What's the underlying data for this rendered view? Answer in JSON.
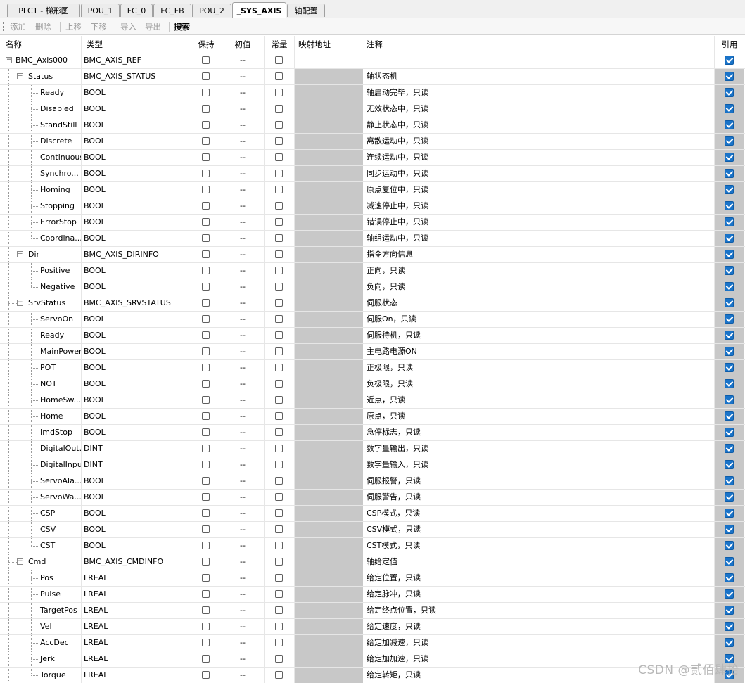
{
  "tabs": [
    {
      "label": "PLC1 - 梯形图"
    },
    {
      "label": "POU_1"
    },
    {
      "label": "FC_0"
    },
    {
      "label": "FC_FB"
    },
    {
      "label": "POU_2"
    },
    {
      "label": "_SYS_AXIS",
      "active": true
    },
    {
      "label": "轴配置"
    }
  ],
  "toolbar": {
    "add": "添加",
    "delete": "删除",
    "move_up": "上移",
    "move_down": "下移",
    "import": "导入",
    "export": "导出",
    "search": "搜索"
  },
  "grid": {
    "columns": {
      "name": "名称",
      "type": "类型",
      "retain": "保持",
      "init": "初值",
      "const": "常量",
      "map": "映射地址",
      "comment": "注释",
      "ref": "引用"
    },
    "rows": [
      {
        "name": "BMC_Axis000",
        "type": "BMC_AXIS_REF",
        "init": "--",
        "comment": "",
        "level": 0,
        "expander": "-"
      },
      {
        "name": "Status",
        "type": "BMC_AXIS_STATUS",
        "init": "--",
        "comment": "轴状态机",
        "level": 1,
        "expander": "-"
      },
      {
        "name": "Ready",
        "type": "BOOL",
        "init": "--",
        "comment": "轴启动完毕，只读",
        "level": 2
      },
      {
        "name": "Disabled",
        "type": "BOOL",
        "init": "--",
        "comment": "无效状态中，只读",
        "level": 2
      },
      {
        "name": "StandStill",
        "type": "BOOL",
        "init": "--",
        "comment": "静止状态中，只读",
        "level": 2
      },
      {
        "name": "Discrete",
        "type": "BOOL",
        "init": "--",
        "comment": "离散运动中，只读",
        "level": 2
      },
      {
        "name": "Continuous",
        "type": "BOOL",
        "init": "--",
        "comment": "连续运动中，只读",
        "level": 2
      },
      {
        "name": "Synchro...",
        "type": "BOOL",
        "init": "--",
        "comment": "同步运动中，只读",
        "level": 2
      },
      {
        "name": "Homing",
        "type": "BOOL",
        "init": "--",
        "comment": "原点复位中，只读",
        "level": 2
      },
      {
        "name": "Stopping",
        "type": "BOOL",
        "init": "--",
        "comment": "减速停止中，只读",
        "level": 2
      },
      {
        "name": "ErrorStop",
        "type": "BOOL",
        "init": "--",
        "comment": "错误停止中，只读",
        "level": 2
      },
      {
        "name": "Coordina...",
        "type": "BOOL",
        "init": "--",
        "comment": "轴组运动中，只读",
        "level": 2,
        "last": true
      },
      {
        "name": "Dir",
        "type": "BMC_AXIS_DIRINFO",
        "init": "--",
        "comment": "指令方向信息",
        "level": 1,
        "expander": "-"
      },
      {
        "name": "Positive",
        "type": "BOOL",
        "init": "--",
        "comment": "正向，只读",
        "level": 2
      },
      {
        "name": "Negative",
        "type": "BOOL",
        "init": "--",
        "comment": "负向，只读",
        "level": 2,
        "last": true
      },
      {
        "name": "SrvStatus",
        "type": "BMC_AXIS_SRVSTATUS",
        "init": "--",
        "comment": "伺服状态",
        "level": 1,
        "expander": "-"
      },
      {
        "name": "ServoOn",
        "type": "BOOL",
        "init": "--",
        "comment": "伺服On，只读",
        "level": 2
      },
      {
        "name": "Ready",
        "type": "BOOL",
        "init": "--",
        "comment": "伺服待机，只读",
        "level": 2
      },
      {
        "name": "MainPower",
        "type": "BOOL",
        "init": "--",
        "comment": "主电路电源ON",
        "level": 2
      },
      {
        "name": "POT",
        "type": "BOOL",
        "init": "--",
        "comment": "正极限，只读",
        "level": 2
      },
      {
        "name": "NOT",
        "type": "BOOL",
        "init": "--",
        "comment": "负极限，只读",
        "level": 2
      },
      {
        "name": "HomeSw...",
        "type": "BOOL",
        "init": "--",
        "comment": "近点，只读",
        "level": 2
      },
      {
        "name": "Home",
        "type": "BOOL",
        "init": "--",
        "comment": "原点，只读",
        "level": 2
      },
      {
        "name": "ImdStop",
        "type": "BOOL",
        "init": "--",
        "comment": "急停标志，只读",
        "level": 2
      },
      {
        "name": "DigitalOut...",
        "type": "DINT",
        "init": "--",
        "comment": "数字量输出，只读",
        "level": 2
      },
      {
        "name": "DigitalInput",
        "type": "DINT",
        "init": "--",
        "comment": "数字量输入，只读",
        "level": 2
      },
      {
        "name": "ServoAla...",
        "type": "BOOL",
        "init": "--",
        "comment": "伺服报警，只读",
        "level": 2
      },
      {
        "name": "ServoWa...",
        "type": "BOOL",
        "init": "--",
        "comment": "伺服警告，只读",
        "level": 2
      },
      {
        "name": "CSP",
        "type": "BOOL",
        "init": "--",
        "comment": "CSP模式，只读",
        "level": 2
      },
      {
        "name": "CSV",
        "type": "BOOL",
        "init": "--",
        "comment": "CSV模式，只读",
        "level": 2
      },
      {
        "name": "CST",
        "type": "BOOL",
        "init": "--",
        "comment": "CST模式，只读",
        "level": 2,
        "last": true
      },
      {
        "name": "Cmd",
        "type": "BMC_AXIS_CMDINFO",
        "init": "--",
        "comment": "轴给定值",
        "level": 1,
        "expander": "-"
      },
      {
        "name": "Pos",
        "type": "LREAL",
        "init": "--",
        "comment": "给定位置，只读",
        "level": 2
      },
      {
        "name": "Pulse",
        "type": "LREAL",
        "init": "--",
        "comment": "给定脉冲，只读",
        "level": 2
      },
      {
        "name": "TargetPos",
        "type": "LREAL",
        "init": "--",
        "comment": "给定终点位置，只读",
        "level": 2
      },
      {
        "name": "Vel",
        "type": "LREAL",
        "init": "--",
        "comment": "给定速度，只读",
        "level": 2
      },
      {
        "name": "AccDec",
        "type": "LREAL",
        "init": "--",
        "comment": "给定加减速，只读",
        "level": 2
      },
      {
        "name": "Jerk",
        "type": "LREAL",
        "init": "--",
        "comment": "给定加加速，只读",
        "level": 2
      },
      {
        "name": "Torque",
        "type": "LREAL",
        "init": "--",
        "comment": "给定转矩，只读",
        "level": 2,
        "last": true
      }
    ]
  },
  "watermark": "CSDN @贰佰肆拾"
}
